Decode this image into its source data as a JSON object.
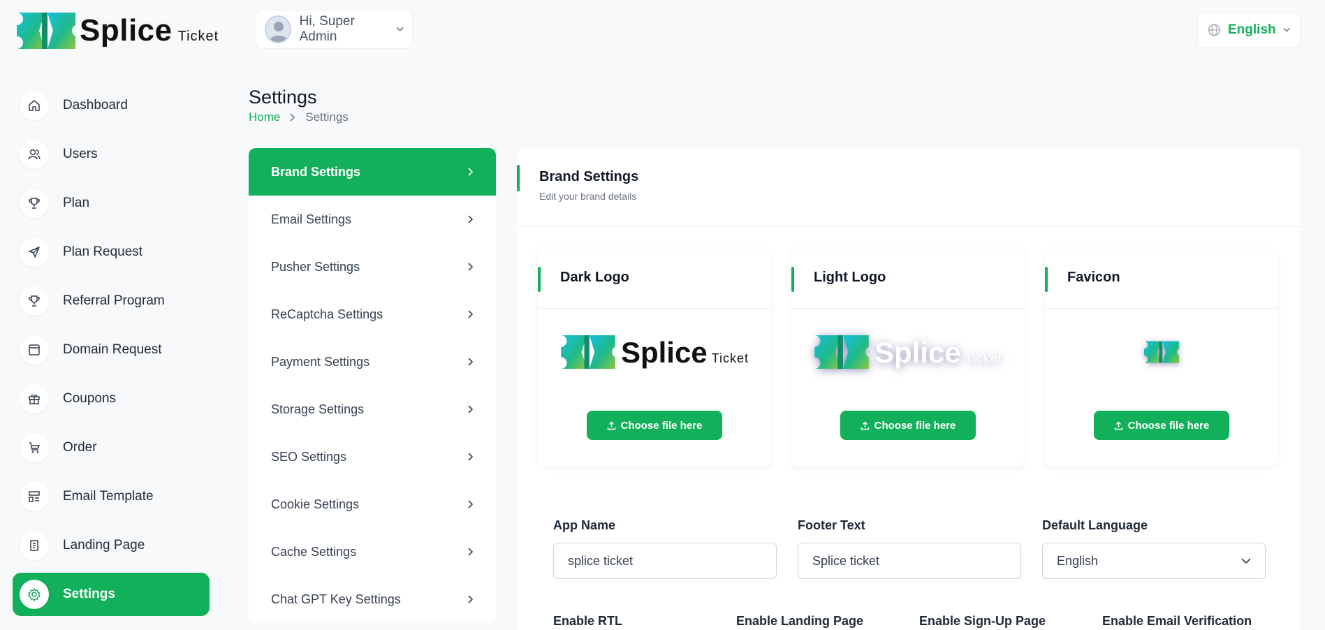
{
  "brand": {
    "name": "Splice",
    "sub": "Ticket"
  },
  "header": {
    "greeting": "Hi, Super Admin",
    "language": "English"
  },
  "sidebar": {
    "items": [
      {
        "label": "Dashboard",
        "icon": "home-icon"
      },
      {
        "label": "Users",
        "icon": "users-icon"
      },
      {
        "label": "Plan",
        "icon": "trophy-icon"
      },
      {
        "label": "Plan Request",
        "icon": "send-icon"
      },
      {
        "label": "Referral Program",
        "icon": "trophy-icon"
      },
      {
        "label": "Domain Request",
        "icon": "browser-icon"
      },
      {
        "label": "Coupons",
        "icon": "gift-icon"
      },
      {
        "label": "Order",
        "icon": "cart-icon"
      },
      {
        "label": "Email Template",
        "icon": "template-icon"
      },
      {
        "label": "Landing Page",
        "icon": "page-icon"
      },
      {
        "label": "Settings",
        "icon": "gear-icon",
        "active": true
      }
    ]
  },
  "page": {
    "title": "Settings",
    "breadcrumb": {
      "home": "Home",
      "current": "Settings"
    }
  },
  "settings_menu": {
    "items": [
      {
        "label": "Brand Settings",
        "active": true
      },
      {
        "label": "Email Settings"
      },
      {
        "label": "Pusher Settings"
      },
      {
        "label": "ReCaptcha Settings"
      },
      {
        "label": "Payment Settings"
      },
      {
        "label": "Storage Settings"
      },
      {
        "label": "SEO Settings"
      },
      {
        "label": "Cookie Settings"
      },
      {
        "label": "Cache Settings"
      },
      {
        "label": "Chat GPT Key Settings"
      }
    ]
  },
  "brand_settings": {
    "title": "Brand Settings",
    "subtitle": "Edit your brand details",
    "cards": [
      {
        "title": "Dark Logo",
        "button": "Choose file here"
      },
      {
        "title": "Light Logo",
        "button": "Choose file here"
      },
      {
        "title": "Favicon",
        "button": "Choose file here"
      }
    ],
    "fields": {
      "app_name": {
        "label": "App Name",
        "value": "splice ticket"
      },
      "footer_text": {
        "label": "Footer Text",
        "value": "Splice ticket"
      },
      "default_language": {
        "label": "Default Language",
        "value": "English"
      }
    },
    "toggles": {
      "rtl": "Enable RTL",
      "landing": "Enable Landing Page",
      "signup": "Enable Sign-Up Page",
      "email_verification": "Enable Email Verification"
    }
  },
  "colors": {
    "accent": "#12b05a",
    "background": "#f8f9fb"
  }
}
